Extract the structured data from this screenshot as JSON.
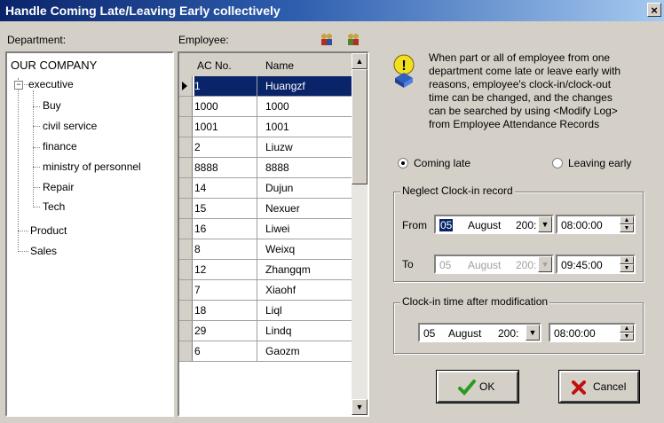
{
  "window": {
    "title": "Handle Coming Late/Leaving Early collectively",
    "close": "×"
  },
  "department": {
    "label": "Department:",
    "tree": [
      {
        "label": "OUR COMPANY"
      },
      {
        "label": "executive",
        "expander": "−"
      },
      {
        "label": "Buy"
      },
      {
        "label": "civil service"
      },
      {
        "label": "finance"
      },
      {
        "label": "ministry of personnel"
      },
      {
        "label": "Repair"
      },
      {
        "label": "Tech"
      },
      {
        "label": "Product"
      },
      {
        "label": "Sales"
      }
    ]
  },
  "employee": {
    "label": "Employee:",
    "columns": [
      "AC No.",
      "Name"
    ],
    "rows": [
      {
        "ac": "1",
        "name": "Huangzf"
      },
      {
        "ac": "1000",
        "name": "1000"
      },
      {
        "ac": "1001",
        "name": "1001"
      },
      {
        "ac": "2",
        "name": "Liuzw"
      },
      {
        "ac": "8888",
        "name": "8888"
      },
      {
        "ac": "14",
        "name": "Dujun"
      },
      {
        "ac": "15",
        "name": "Nexuer"
      },
      {
        "ac": "16",
        "name": "Liwei"
      },
      {
        "ac": "8",
        "name": "Weixq"
      },
      {
        "ac": "12",
        "name": "Zhangqm"
      },
      {
        "ac": "7",
        "name": "Xiaohf"
      },
      {
        "ac": "18",
        "name": "Liql"
      },
      {
        "ac": "29",
        "name": "Lindq"
      },
      {
        "ac": "6",
        "name": "Gaozm"
      }
    ]
  },
  "info_text": [
    "When part or all of employee from one",
    "department come late or leave early with",
    "reasons, employee's clock-in/clock-out",
    "time can be changed, and the changes",
    "can be searched  by using <Modify Log>",
    "from Employee Attendance Records"
  ],
  "mode": {
    "coming_late": "Coming late",
    "leaving_early": "Leaving early",
    "selected": "coming_late"
  },
  "neglect": {
    "title": "Neglect Clock-in record",
    "from_label": "From",
    "to_label": "To",
    "from_day": "05",
    "from_month": "August",
    "from_year": "200:",
    "from_time": "08:00:00",
    "to_day": "05",
    "to_month": "August",
    "to_year": "200:",
    "to_time": "09:45:00"
  },
  "modified": {
    "title": "Clock-in time after modification",
    "day": "05",
    "month": "August",
    "year": "200:",
    "time": "08:00:00"
  },
  "buttons": {
    "ok": "OK",
    "cancel": "Cancel"
  },
  "colors": {
    "titlebar": "#0a246a",
    "selection": "#0a246a",
    "face": "#d4d0c8"
  }
}
